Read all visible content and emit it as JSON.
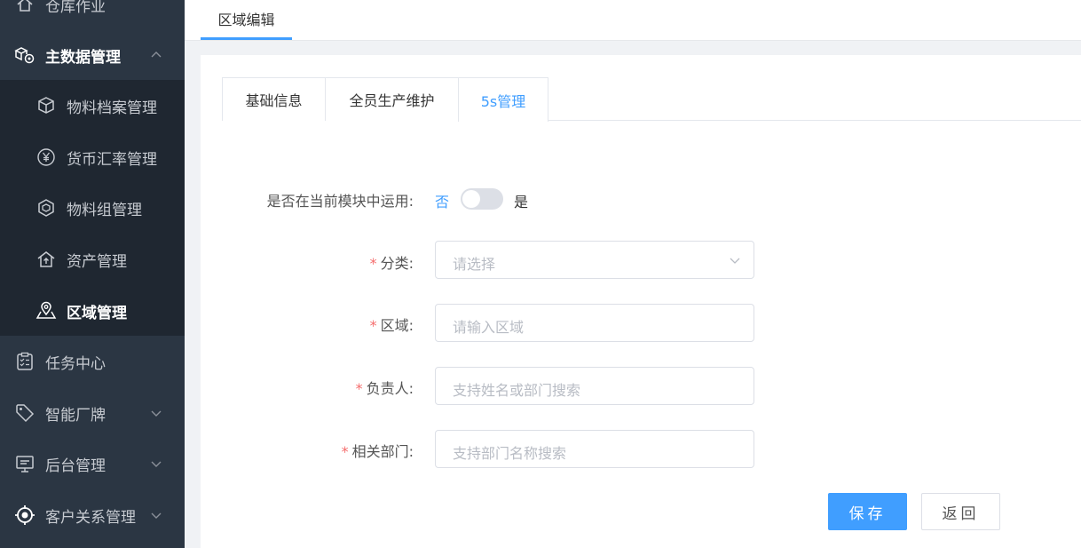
{
  "sidebar": {
    "top_item": {
      "label": "仓库作业",
      "icon": "home-icon"
    },
    "master": {
      "label": "主数据管理",
      "icon": "boxes-icon"
    },
    "sub_items": [
      {
        "label": "物料档案管理",
        "icon": "cube-icon"
      },
      {
        "label": "货币汇率管理",
        "icon": "currency-icon"
      },
      {
        "label": "物料组管理",
        "icon": "hexagon-icon"
      },
      {
        "label": "资产管理",
        "icon": "house-upload-icon"
      },
      {
        "label": "区域管理",
        "icon": "map-pin-icon"
      }
    ],
    "lower_items": [
      {
        "label": "任务中心",
        "icon": "clipboard-icon"
      },
      {
        "label": "智能厂牌",
        "icon": "tag-icon"
      },
      {
        "label": "后台管理",
        "icon": "monitor-icon"
      },
      {
        "label": "客户关系管理",
        "icon": "target-icon"
      }
    ],
    "colors": {
      "bg": "#2b3643",
      "submenu_bg": "#1f2731",
      "text": "#c7cbd1"
    }
  },
  "page_tab": {
    "label": "区域编辑"
  },
  "form_tabs": [
    {
      "label": "基础信息"
    },
    {
      "label": "全员生产维护"
    },
    {
      "label": "5s管理"
    }
  ],
  "form": {
    "switch_row": {
      "label": "是否在当前模块中运用:",
      "off_text": "否",
      "on_text": "是"
    },
    "category": {
      "label": "分类:",
      "placeholder": "请选择"
    },
    "area": {
      "label": "区域:",
      "placeholder": "请输入区域"
    },
    "owner": {
      "label": "负责人:",
      "placeholder": "支持姓名或部门搜索"
    },
    "dept": {
      "label": "相关部门:",
      "placeholder": "支持部门名称搜索"
    },
    "required_mark": "*"
  },
  "buttons": {
    "save": "保存",
    "back": "返回"
  },
  "accent_color": "#409eff"
}
